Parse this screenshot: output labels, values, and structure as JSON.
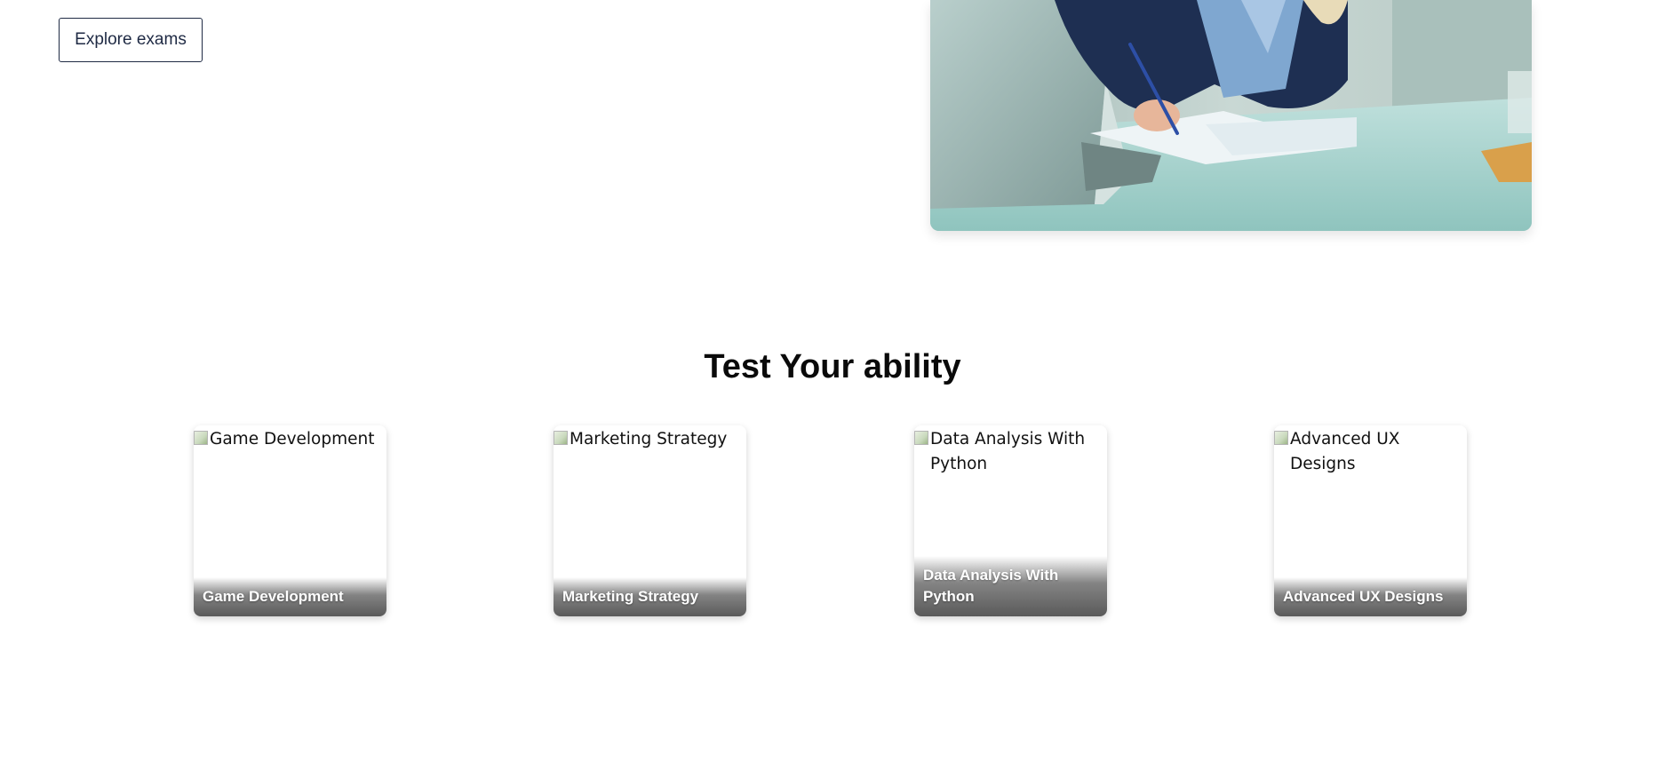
{
  "hero": {
    "explore_button_label": "Explore exams"
  },
  "section": {
    "title": "Test Your ability"
  },
  "exams": [
    {
      "image_alt": "Game Development",
      "title": "Game Development"
    },
    {
      "image_alt": "Marketing Strategy",
      "title": "Marketing Strategy"
    },
    {
      "image_alt": "Data Analysis With Python",
      "title": "Data Analysis With Python"
    },
    {
      "image_alt": "Advanced UX Designs",
      "title": "Advanced UX Designs"
    }
  ],
  "colors": {
    "button_border": "#1f2a44",
    "title_text": "#0a0a0a",
    "caption_overlay": "#5a5a5a"
  }
}
